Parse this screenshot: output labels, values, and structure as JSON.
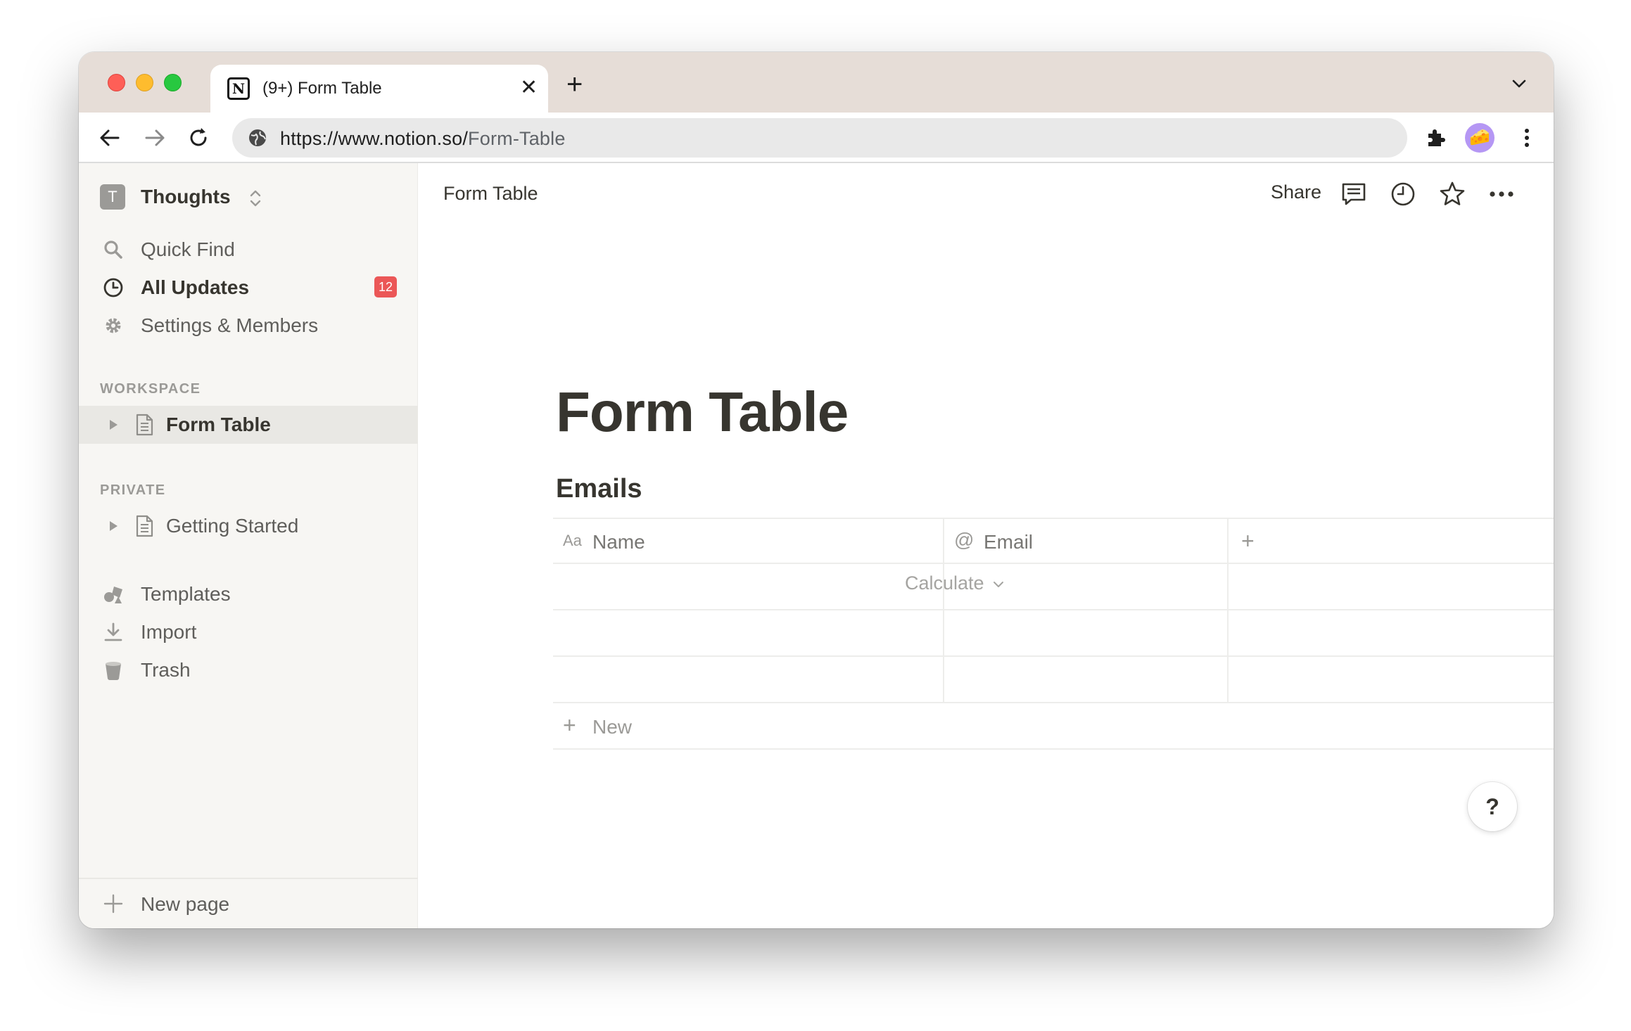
{
  "browser": {
    "tab_title": "(9+) Form Table",
    "favicon_letter": "N",
    "url_host": "https://www.notion.so/",
    "url_path": "Form-Table",
    "profile_emoji": "🧀"
  },
  "sidebar": {
    "workspace_initial": "T",
    "workspace_name": "Thoughts",
    "quick_find": "Quick Find",
    "all_updates": "All Updates",
    "updates_count": "12",
    "settings": "Settings & Members",
    "section_workspace": "WORKSPACE",
    "section_private": "PRIVATE",
    "pages_workspace": [
      "Form Table"
    ],
    "pages_private": [
      "Getting Started"
    ],
    "templates": "Templates",
    "import": "Import",
    "trash": "Trash",
    "new_page": "New page"
  },
  "topbar": {
    "breadcrumb": "Form Table",
    "share": "Share"
  },
  "page": {
    "title": "Form Table",
    "database_title": "Emails",
    "columns": [
      {
        "icon": "Aa",
        "label": "Name"
      },
      {
        "icon": "@",
        "label": "Email"
      }
    ],
    "rows": [
      [
        "",
        ""
      ],
      [
        "",
        ""
      ],
      [
        "",
        ""
      ]
    ],
    "new_row": "New",
    "calculate": "Calculate",
    "help": "?"
  },
  "colors": {
    "badge": "#eb5757",
    "sidebar_bg": "#f7f6f3",
    "text": "#37352f",
    "tabstrip": "#e6ddd7"
  }
}
